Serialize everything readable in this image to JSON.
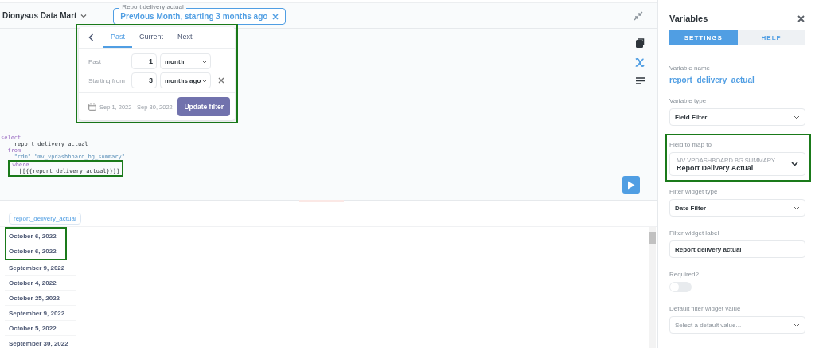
{
  "topbar": {
    "database": "Dionysus Data Mart",
    "filter_chip": {
      "label": "Report delivery actual",
      "value": "Previous Month, starting 3 months ago"
    }
  },
  "popover": {
    "highlighted": true,
    "tabs": [
      {
        "label": "Past",
        "selected": true
      },
      {
        "label": "Current",
        "selected": false
      },
      {
        "label": "Next",
        "selected": false
      }
    ],
    "rows": [
      {
        "label": "Past",
        "number": "1",
        "unit": "month",
        "removable": false
      },
      {
        "label": "Starting from",
        "number": "3",
        "unit": "months ago",
        "removable": true
      }
    ],
    "date_range": "Sep 1, 2022 - Sep 30, 2022",
    "button": "Update filter"
  },
  "editor": {
    "lines": [
      {
        "kind": "keyword",
        "text": "select",
        "highlighted": false
      },
      {
        "kind": "text",
        "text": "    report_delivery_actual",
        "highlighted": false
      },
      {
        "kind": "keyword",
        "text": "  from",
        "highlighted": false
      },
      {
        "kind": "string",
        "text": "    \"cdm\".\"mv_vpdashboard_bg_summary\"",
        "highlighted": false
      },
      {
        "kind": "keyword",
        "text": "  where",
        "highlighted": true
      },
      {
        "kind": "text",
        "text": "    [[{{report_delivery_actual}}]]",
        "highlighted": true
      }
    ]
  },
  "results": {
    "column": "report_delivery_actual",
    "rows": [
      {
        "value": "October 6, 2022",
        "highlighted": true
      },
      {
        "value": "October 6, 2022",
        "highlighted": true
      },
      {
        "value": "September 9, 2022",
        "highlighted": false
      },
      {
        "value": "October 4, 2022",
        "highlighted": false
      },
      {
        "value": "October 25, 2022",
        "highlighted": false
      },
      {
        "value": "September 9, 2022",
        "highlighted": false
      },
      {
        "value": "October 5, 2022",
        "highlighted": false
      },
      {
        "value": "September 30, 2022",
        "highlighted": false
      }
    ]
  },
  "panel": {
    "title": "Variables",
    "tabs": [
      {
        "label": "SETTINGS",
        "selected": true
      },
      {
        "label": "HELP",
        "selected": false
      }
    ],
    "fields": [
      {
        "kind": "text",
        "label": "Variable name",
        "value": "report_delivery_actual",
        "highlighted": false
      },
      {
        "kind": "select",
        "label": "Variable type",
        "value": "Field Filter",
        "highlighted": false
      },
      {
        "kind": "mapping",
        "label": "Field to map to",
        "caption": "MV VPDASHBOARD BG SUMMARY",
        "value": "Report Delivery Actual",
        "highlighted": true
      },
      {
        "kind": "select",
        "label": "Filter widget type",
        "value": "Date Filter",
        "highlighted": false
      },
      {
        "kind": "input",
        "label": "Filter widget label",
        "value": "Report delivery actual",
        "highlighted": false
      },
      {
        "kind": "toggle",
        "label": "Required?",
        "on": false,
        "highlighted": false
      },
      {
        "kind": "select",
        "label": "Default filter widget value",
        "placeholder": "Select a default value...",
        "highlighted": false
      }
    ]
  }
}
